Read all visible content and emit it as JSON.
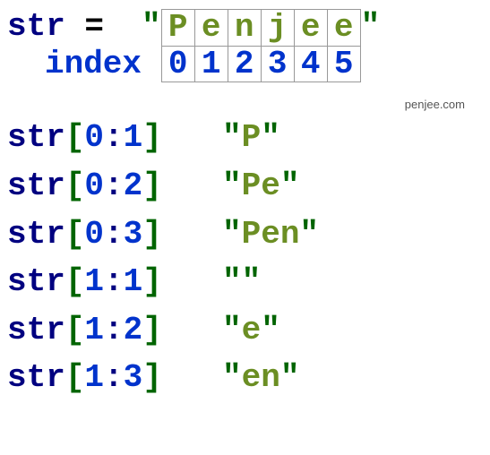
{
  "header": {
    "var_name": "str",
    "equals": " = ",
    "open_quote": "\"",
    "close_quote": "\"",
    "chars": [
      "P",
      "e",
      "n",
      "j",
      "e",
      "e"
    ],
    "indices": [
      "0",
      "1",
      "2",
      "3",
      "4",
      "5"
    ],
    "index_label": "index"
  },
  "attribution": "penjee.com",
  "examples": [
    {
      "var": "str",
      "lb": "[",
      "a": "0",
      "colon": ":",
      "b": "1",
      "rb": "]",
      "q1": "\"",
      "res": "P",
      "q2": "\""
    },
    {
      "var": "str",
      "lb": "[",
      "a": "0",
      "colon": ":",
      "b": "2",
      "rb": "]",
      "q1": "\"",
      "res": "Pe",
      "q2": "\""
    },
    {
      "var": "str",
      "lb": "[",
      "a": "0",
      "colon": ":",
      "b": "3",
      "rb": "]",
      "q1": "\"",
      "res": "Pen",
      "q2": "\""
    },
    {
      "var": "str",
      "lb": "[",
      "a": "1",
      "colon": ":",
      "b": "1",
      "rb": "]",
      "q1": "\"",
      "res": "",
      "q2": "\""
    },
    {
      "var": "str",
      "lb": "[",
      "a": "1",
      "colon": ":",
      "b": "2",
      "rb": "]",
      "q1": "\"",
      "res": "e",
      "q2": "\""
    },
    {
      "var": "str",
      "lb": "[",
      "a": "1",
      "colon": ":",
      "b": "3",
      "rb": "]",
      "q1": "\"",
      "res": "en",
      "q2": "\""
    }
  ]
}
